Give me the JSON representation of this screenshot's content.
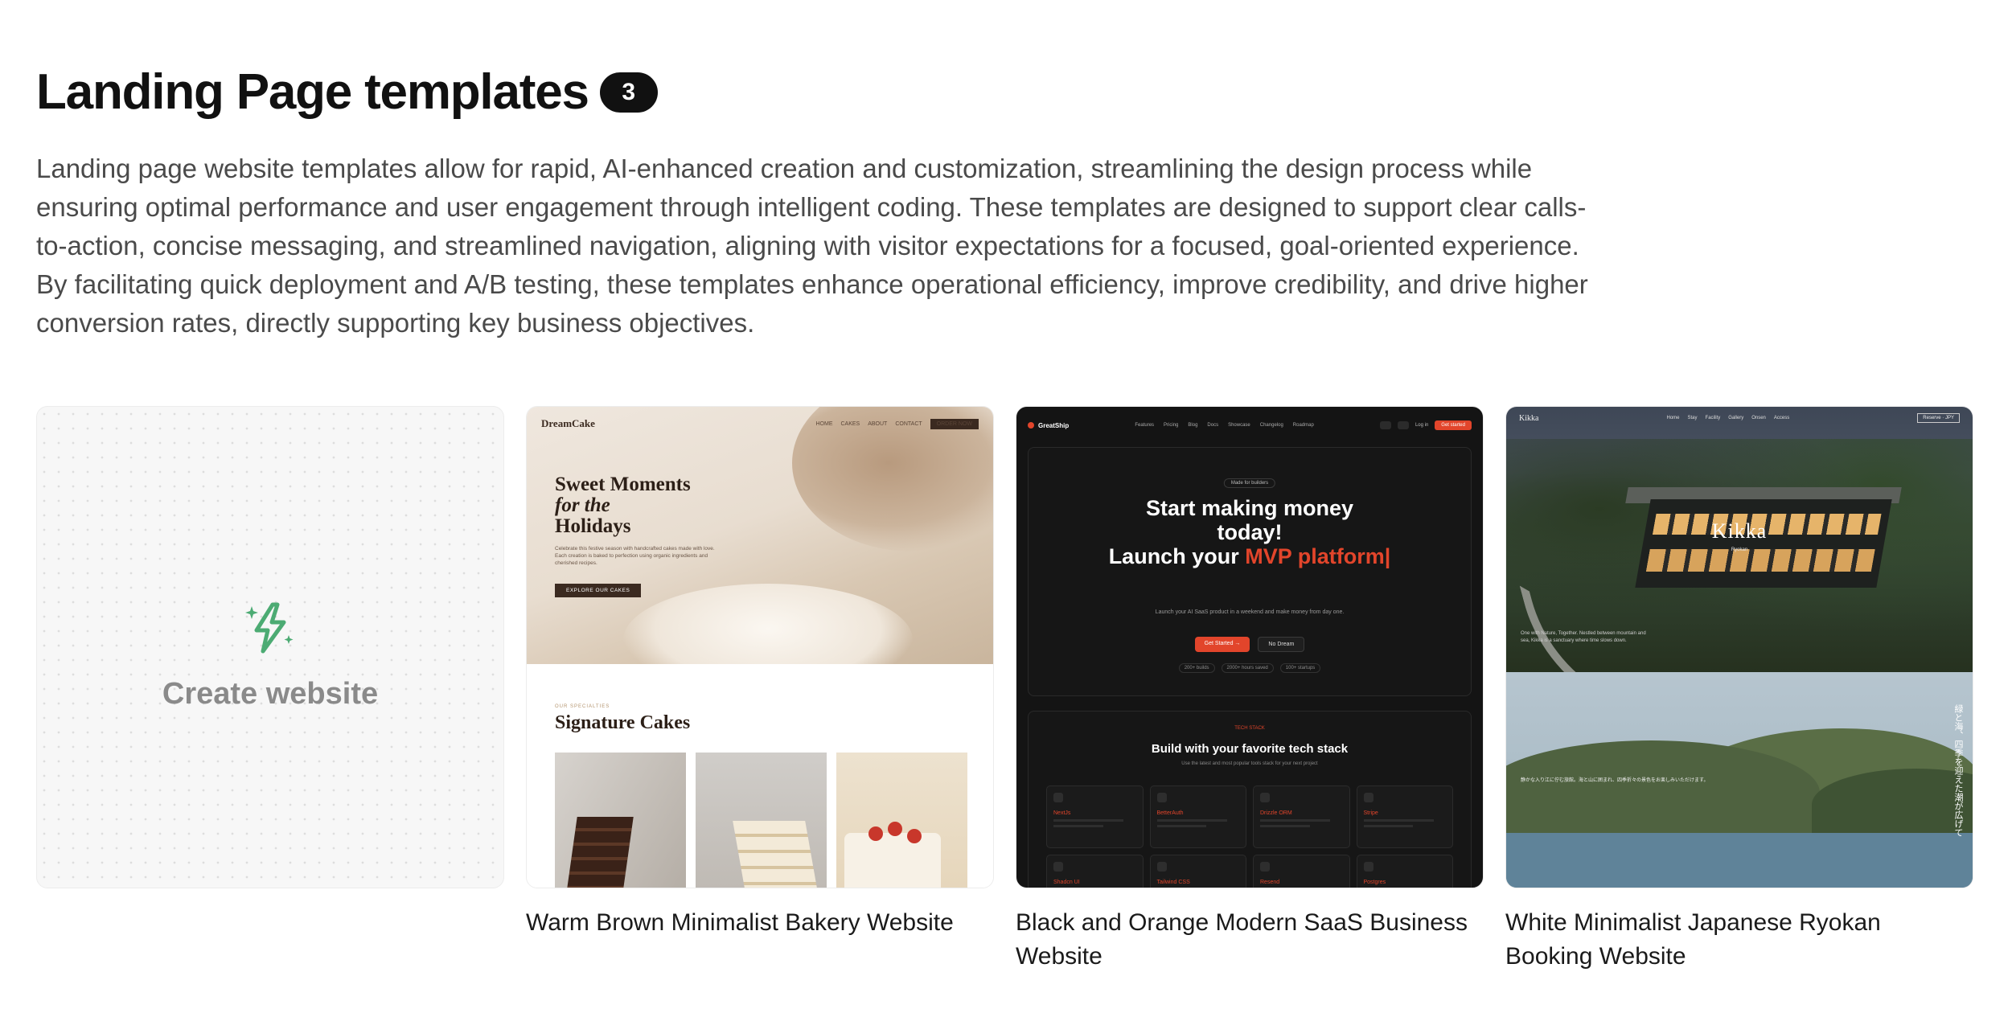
{
  "section": {
    "title": "Landing Page templates",
    "count": "3",
    "description": "Landing page website templates allow for rapid, AI-enhanced creation and customization, streamlining the design process while ensuring optimal performance and user engagement through intelligent coding. These templates are designed to support clear calls-to-action, concise messaging, and streamlined navigation, aligning with visitor expectations for a focused, goal-oriented experience. By facilitating quick deployment and A/B testing, these templates enhance operational efficiency, improve credibility, and drive higher conversion rates, directly supporting key business objectives."
  },
  "create_card": {
    "label": "Create website",
    "icon": "sparkle-bolt-icon",
    "icon_color": "#4cab73"
  },
  "templates": [
    {
      "caption": "Warm Brown Minimalist Bakery Website",
      "preview": {
        "logo": "DreamCake",
        "nav": [
          "HOME",
          "CAKES",
          "ABOUT",
          "CONTACT"
        ],
        "order_button": "ORDER NOW",
        "hero_line1": "Sweet Moments",
        "hero_line2": "for the",
        "hero_line3": "Holidays",
        "hero_sub": "Celebrate this festive season with handcrafted cakes made with love. Each creation is baked to perfection using organic ingredients and cherished recipes.",
        "cta": "EXPLORE OUR CAKES",
        "eyebrow": "OUR SPECIALTIES",
        "section_title": "Signature Cakes"
      }
    },
    {
      "caption": "Black and Orange Modern SaaS Business Website",
      "preview": {
        "logo": "GreatShip",
        "nav": [
          "Features",
          "Pricing",
          "Blog",
          "Docs",
          "Showcase",
          "Changelog",
          "Roadmap"
        ],
        "signin": "Log in",
        "get_started_small": "Get started",
        "tag": "Made for builders",
        "headline1": "Start making money",
        "headline2": "today!",
        "headline3": "Launch your",
        "headline_accent": "MVP platform|",
        "hero_sub": "Launch your AI SaaS product in a weekend and make money from day one.",
        "cta_primary": "Get Started  →",
        "cta_secondary": "No Dream",
        "stats": [
          "200+ builds",
          "2000+ hours saved",
          "100+ startups"
        ],
        "tech_eyebrow": "TECH STACK",
        "tech_title": "Build with your favorite tech stack",
        "tech_sub": "Use the latest and most popular tools stack for your next project",
        "tech_items": [
          "NextJs",
          "BetterAuth",
          "Drizzle ORM",
          "Stripe",
          "Shadcn UI",
          "Tailwind CSS",
          "Resend",
          "Postgres"
        ]
      }
    },
    {
      "caption": "White Minimalist Japanese Ryokan Booking Website",
      "preview": {
        "logo": "Kikka",
        "nav": [
          "Home",
          "Stay",
          "Facility",
          "Gallery",
          "Onsen",
          "Access"
        ],
        "reserve": "Reserve · JPY",
        "title": "Kikka",
        "subtitle": "Ryokan",
        "caption_text": "One with Nature, Together. Nestled between mountain and sea, Kikka is a sanctuary where time slows down.",
        "body_text": "静かな入り江に佇む旅館。海と山に囲まれ、四季折々の景色をお楽しみいただけます。",
        "vertical_text": "緑と海、四季を迎えた潮が広げて"
      }
    }
  ]
}
